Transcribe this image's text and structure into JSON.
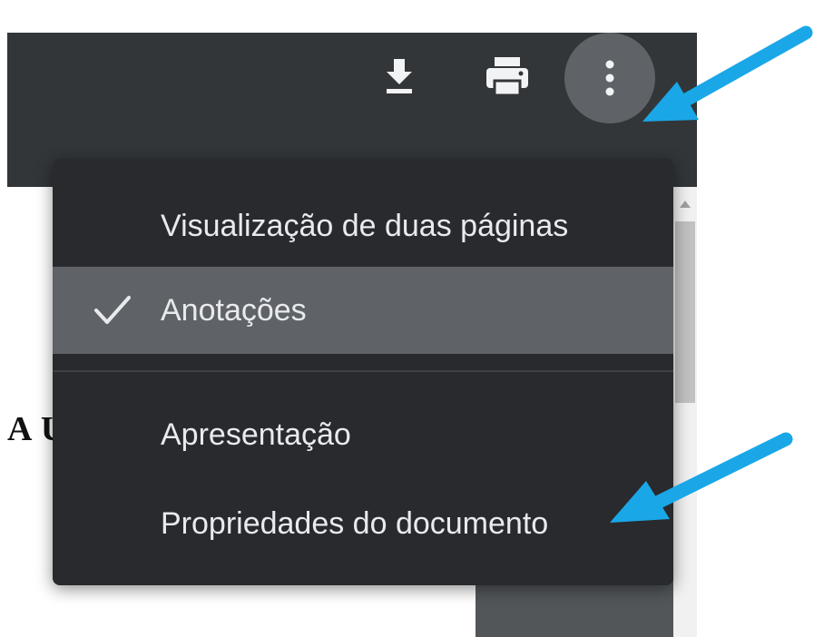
{
  "toolbar": {
    "icons": [
      "download-icon",
      "print-icon",
      "more-vert-icon"
    ]
  },
  "document": {
    "visible_text": "A U"
  },
  "menu": {
    "items": [
      {
        "label": "Visualização de duas páginas",
        "selected": false,
        "checked": false
      },
      {
        "label": "Anotações",
        "selected": true,
        "checked": true,
        "check_icon": "check-icon"
      },
      {
        "label": "Apresentação",
        "selected": false,
        "checked": false
      },
      {
        "label": "Propriedades do documento",
        "selected": false,
        "checked": false
      }
    ]
  },
  "colors": {
    "toolbar_bg": "#323639",
    "menu_bg": "#292a2d",
    "menu_selected_bg": "#5f6368",
    "menu_text": "#e8eaed",
    "more_button_bg": "#5f6368",
    "annotation_arrow": "#1aa7e8"
  }
}
